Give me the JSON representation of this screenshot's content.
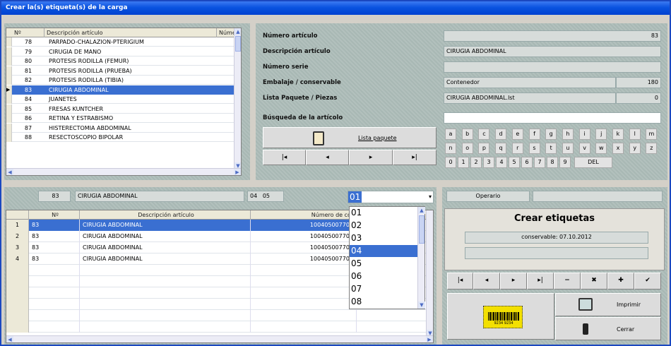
{
  "window": {
    "title": "Crear la(s) etiqueta(s) de la carga"
  },
  "articles": {
    "columns": [
      "Nº",
      "Descripción artículo",
      "Núme"
    ],
    "rows": [
      {
        "num": "78",
        "desc": "PARPADO-CHALAZION-PTERIGIUM"
      },
      {
        "num": "79",
        "desc": "CIRUGIA DE MANO"
      },
      {
        "num": "80",
        "desc": "PROTESIS RODILLA (FEMUR)"
      },
      {
        "num": "81",
        "desc": "PROTESIS RODILLA (PRUEBA)"
      },
      {
        "num": "82",
        "desc": "PROTESIS RODILLA (TIBIA)"
      },
      {
        "num": "83",
        "desc": "CIRUGIA ABDOMINAL"
      },
      {
        "num": "84",
        "desc": "JUANETES"
      },
      {
        "num": "85",
        "desc": "FRESAS KUNTCHER"
      },
      {
        "num": "86",
        "desc": "RETINA Y ESTRABISMO"
      },
      {
        "num": "87",
        "desc": "HISTERECTOMIA ABDOMINAL"
      },
      {
        "num": "88",
        "desc": "RESECTOSCOPIO BIPOLAR"
      }
    ],
    "selected_index": 5
  },
  "details": {
    "numero_articulo_label": "Número artículo",
    "numero_articulo": "83",
    "descripcion_label": "Descripción artículo",
    "descripcion": "CIRUGIA ABDOMINAL",
    "numero_serie_label": "Número serie",
    "numero_serie": "",
    "embalaje_label": "Embalaje / conservable",
    "embalaje": "Contenedor",
    "embalaje_num": "180",
    "lista_label": "Lista Paquete / Piezas",
    "lista": "CIRUGIA ABDOMINAL.lst",
    "lista_num": "0",
    "busqueda_label": "Búsqueda de la artícolo",
    "busqueda_value": "",
    "lista_paquete_button": "Lista paquete"
  },
  "nav": {
    "first": "|◂",
    "prev": "◂",
    "next": "▸",
    "last": "▸|"
  },
  "keyboard": {
    "row1": [
      "a",
      "b",
      "c",
      "d",
      "e",
      "f",
      "g",
      "h",
      "i",
      "j",
      "k",
      "l",
      "m"
    ],
    "row2": [
      "n",
      "o",
      "p",
      "q",
      "r",
      "s",
      "t",
      "u",
      "v",
      "w",
      "x",
      "y",
      "z"
    ],
    "row3": [
      "0",
      "1",
      "2",
      "3",
      "4",
      "5",
      "6",
      "7",
      "8",
      "9"
    ],
    "del": "DEL"
  },
  "current": {
    "num": "83",
    "desc": "CIRUGIA ABDOMINAL",
    "a": "04",
    "b": "05",
    "combo": "01"
  },
  "labels": {
    "columns": [
      "Nº",
      "Descripción artículo",
      "Número de cód"
    ],
    "rows": [
      {
        "idx": "1",
        "num": "83",
        "desc": "CIRUGIA ABDOMINAL",
        "code": "100405007701"
      },
      {
        "idx": "2",
        "num": "83",
        "desc": "CIRUGIA ABDOMINAL",
        "code": "100405007701"
      },
      {
        "idx": "3",
        "num": "83",
        "desc": "CIRUGIA ABDOMINAL",
        "code": "100405007701"
      },
      {
        "idx": "4",
        "num": "83",
        "desc": "CIRUGIA ABDOMINAL",
        "code": "100405007701"
      }
    ]
  },
  "dropdown": {
    "options": [
      "01",
      "02",
      "03",
      "04",
      "05",
      "06",
      "07",
      "08"
    ],
    "highlighted": 3
  },
  "right": {
    "operario_label": "Operario",
    "operario_value": "",
    "heading": "Crear etiquetas",
    "conservable": "conservable: 07.10.2012",
    "status2": "",
    "controls": {
      "minus": "−",
      "delete": "✖",
      "plus": "✚",
      "ok": "✔"
    },
    "print": "Imprimir",
    "close": "Cerrar",
    "barcode_text": "9234  9234"
  },
  "colors": {
    "title": "#0a53e0",
    "selection": "#3a6fd1",
    "panel": "#a8b8b4"
  }
}
